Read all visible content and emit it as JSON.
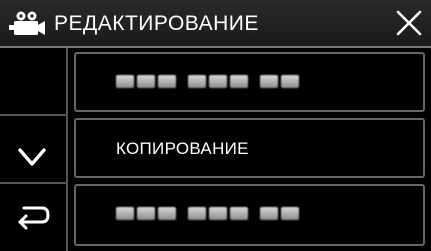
{
  "header": {
    "title": "РЕДАКТИРОВАНИЕ",
    "mode_icon": "movie-camera-icon",
    "close_icon": "close-icon"
  },
  "navigation": {
    "scroll_icon": "chevron-down-icon",
    "back_icon": "return-arrow-icon"
  },
  "menu": {
    "items": [
      {
        "label": "",
        "obscured": true
      },
      {
        "label": "КОПИРОВАНИЕ",
        "obscured": false
      },
      {
        "label": "",
        "obscured": true
      }
    ]
  },
  "colors": {
    "background": "#000000",
    "text": "#ffffff",
    "border": "#666666"
  }
}
